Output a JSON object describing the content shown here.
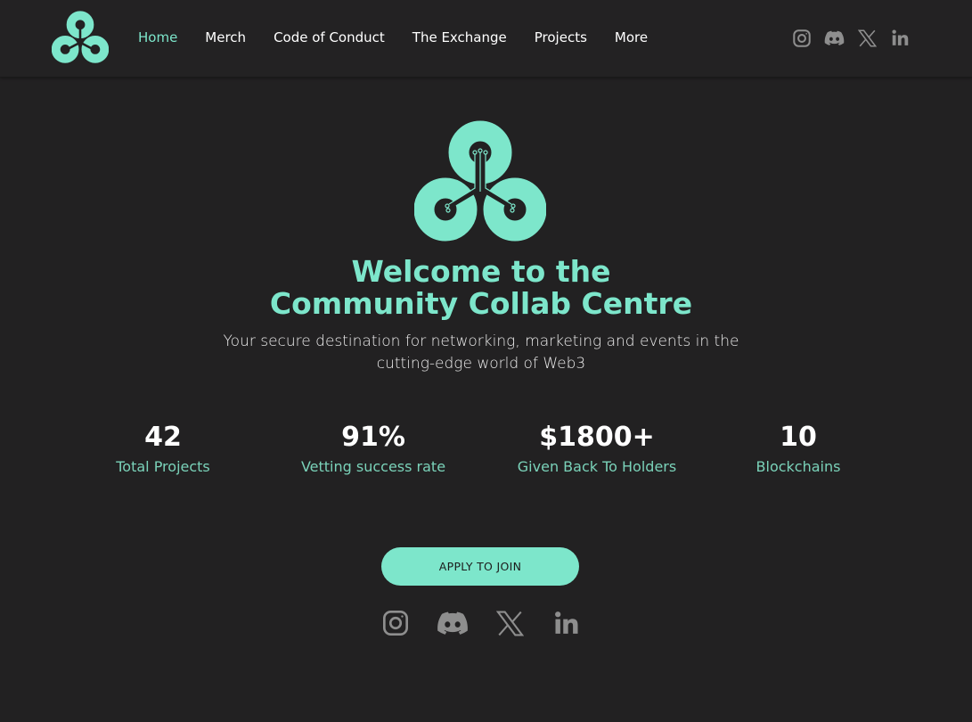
{
  "colors": {
    "accent": "#7de6cb",
    "background": "#222122",
    "text": "#ffffff",
    "icon": "#8e8e8e"
  },
  "header": {
    "logo_icon": "triskelion-logo-icon",
    "nav": [
      {
        "label": "Home",
        "active": true
      },
      {
        "label": "Merch",
        "active": false
      },
      {
        "label": "Code of Conduct",
        "active": false
      },
      {
        "label": "The Exchange",
        "active": false
      },
      {
        "label": "Projects",
        "active": false
      },
      {
        "label": "More",
        "active": false
      }
    ],
    "social_icons": [
      "instagram-icon",
      "discord-icon",
      "x-icon",
      "linkedin-icon"
    ]
  },
  "hero": {
    "logo_icon": "triskelion-logo-icon",
    "title_line1": "Welcome to the",
    "title_line2": "Community Collab Centre",
    "subtitle_line1": "Your secure destination for networking, marketing and events in the",
    "subtitle_line2": "cutting-edge world of Web3"
  },
  "stats": [
    {
      "value": "42",
      "label": "Total Projects"
    },
    {
      "value": "91%",
      "label": "Vetting success rate"
    },
    {
      "value": "$1800+",
      "label": "Given Back To Holders"
    },
    {
      "value": "10",
      "label": "Blockchains"
    }
  ],
  "cta": {
    "label": "APPLY TO JOIN"
  },
  "footer": {
    "social_icons": [
      "instagram-icon",
      "discord-icon",
      "x-icon",
      "linkedin-icon"
    ]
  }
}
